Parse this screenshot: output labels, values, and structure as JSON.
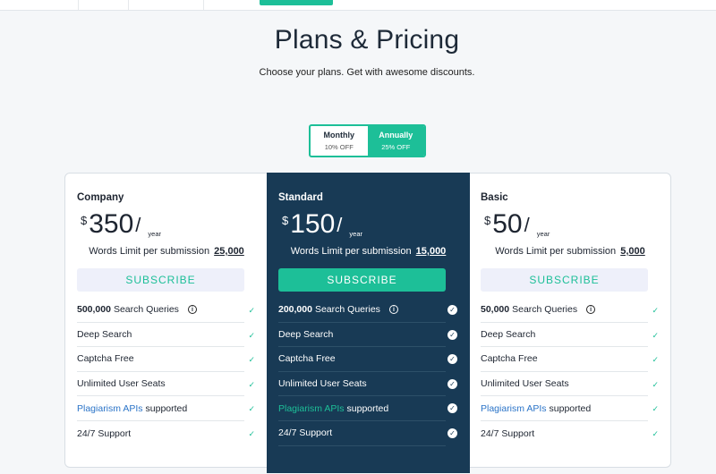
{
  "header": {
    "title": "Plans & Pricing",
    "subtitle": "Choose your plans. Get with awesome discounts."
  },
  "billing_toggle": {
    "options": [
      {
        "label": "Monthly",
        "discount": "10% OFF",
        "selected": false
      },
      {
        "label": "Annually",
        "discount": "25% OFF",
        "selected": true
      }
    ]
  },
  "plans": [
    {
      "name": "Company",
      "currency": "$",
      "price": "350",
      "slash": "/",
      "period": "year",
      "words_label": "Words Limit per submission",
      "words_limit": "25,000",
      "subscribe_label": "SUBSCRIBE",
      "features": [
        {
          "bold": "500,000",
          "text": "Search Queries",
          "info": "i",
          "check": "✓"
        },
        {
          "text": "Deep Search",
          "check": "✓"
        },
        {
          "text": "Captcha Free",
          "check": "✓"
        },
        {
          "text": "Unlimited User Seats",
          "check": "✓"
        },
        {
          "link": "Plagiarism APIs",
          "text": "supported",
          "check": "✓"
        },
        {
          "text": "24/7 Support",
          "check": "✓"
        }
      ]
    },
    {
      "name": "Standard",
      "currency": "$",
      "price": "150",
      "slash": "/",
      "period": "year",
      "words_label": "Words Limit per submission",
      "words_limit": "15,000",
      "subscribe_label": "SUBSCRIBE",
      "features": [
        {
          "bold": "200,000",
          "text": "Search Queries",
          "info": "i",
          "check": "✓"
        },
        {
          "text": "Deep Search",
          "check": "✓"
        },
        {
          "text": "Captcha Free",
          "check": "✓"
        },
        {
          "text": "Unlimited User Seats",
          "check": "✓"
        },
        {
          "link": "Plagiarism APIs",
          "text": "supported",
          "check": "✓"
        },
        {
          "text": "24/7 Support",
          "check": "✓"
        }
      ]
    },
    {
      "name": "Basic",
      "currency": "$",
      "price": "50",
      "slash": "/",
      "period": "year",
      "words_label": "Words Limit per submission",
      "words_limit": "5,000",
      "subscribe_label": "SUBSCRIBE",
      "features": [
        {
          "bold": "50,000",
          "text": "Search Queries",
          "info": "i",
          "check": "✓"
        },
        {
          "text": "Deep Search",
          "check": "✓"
        },
        {
          "text": "Captcha Free",
          "check": "✓"
        },
        {
          "text": "Unlimited User Seats",
          "check": "✓"
        },
        {
          "link": "Plagiarism APIs",
          "text": "supported",
          "check": "✓"
        },
        {
          "text": "24/7 Support",
          "check": "✓"
        }
      ]
    }
  ],
  "colors": {
    "accent": "#1dbf98",
    "featured_bg": "#183a55",
    "link": "#2b74c8"
  }
}
